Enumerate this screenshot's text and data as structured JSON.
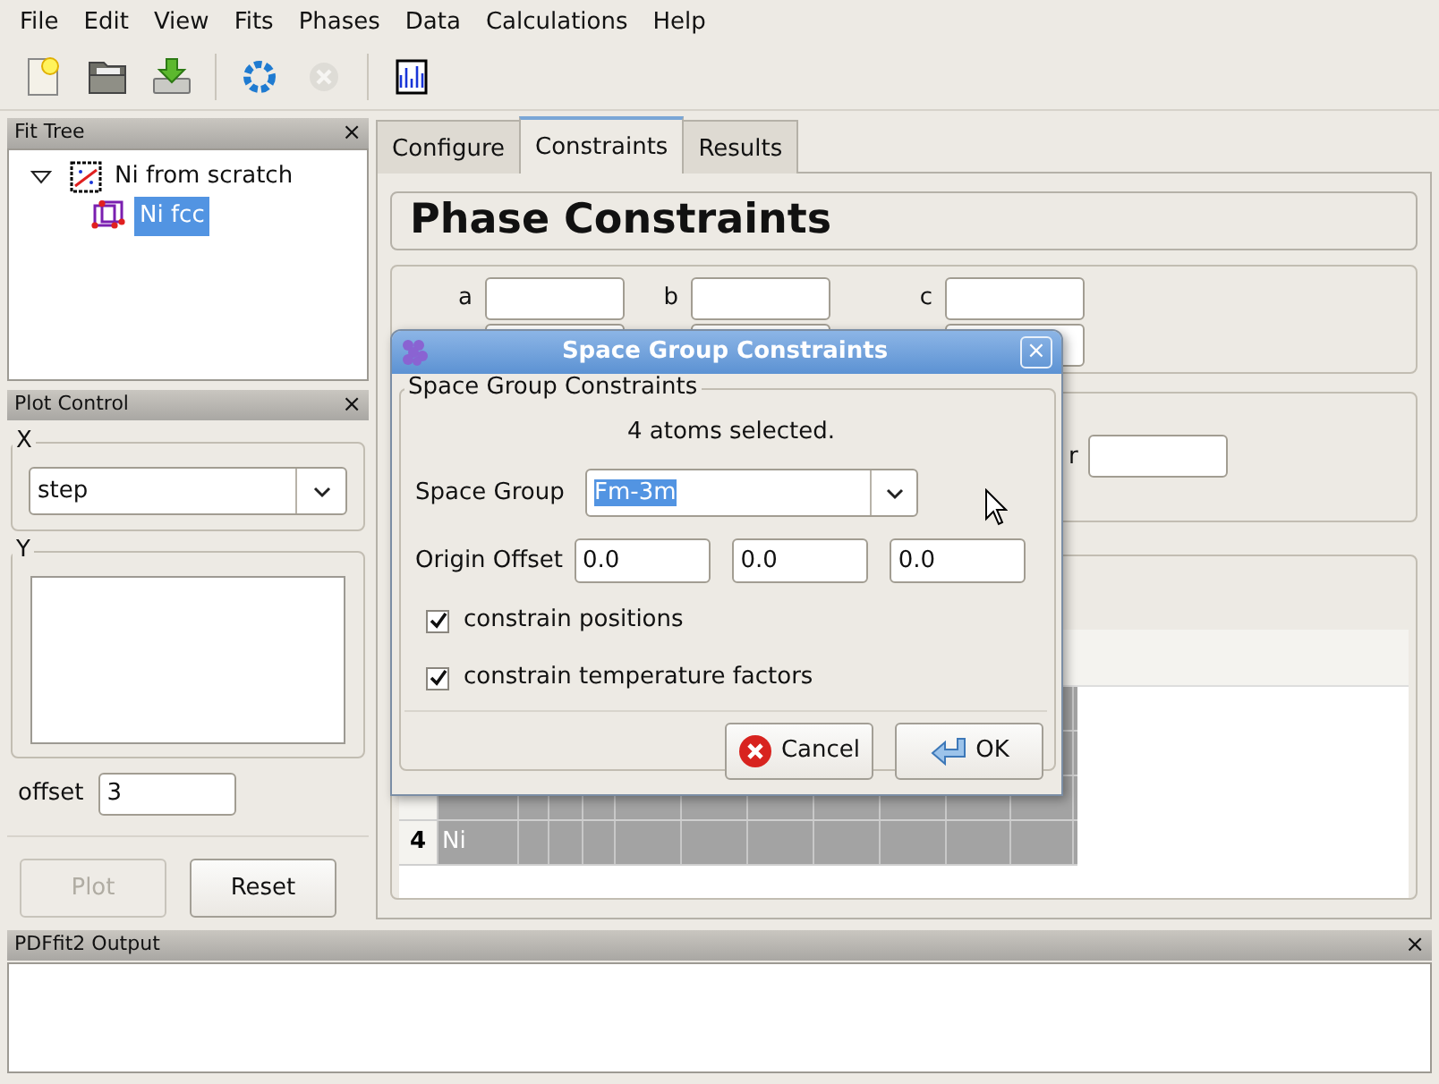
{
  "menu": [
    "File",
    "Edit",
    "View",
    "Fits",
    "Phases",
    "Data",
    "Calculations",
    "Help"
  ],
  "toolbar": [
    {
      "kind": "new",
      "disabled": false
    },
    {
      "kind": "open",
      "disabled": false
    },
    {
      "kind": "save",
      "disabled": false
    },
    {
      "kind": "sep"
    },
    {
      "kind": "run",
      "disabled": false
    },
    {
      "kind": "stop",
      "disabled": true
    },
    {
      "kind": "sep"
    },
    {
      "kind": "plot",
      "disabled": false
    }
  ],
  "fit_tree": {
    "title": "Fit Tree",
    "close": "×",
    "items": [
      {
        "label": "Ni from scratch",
        "kind": "fit",
        "expanded": true,
        "selected": false,
        "children": [
          {
            "label": "Ni fcc",
            "kind": "phase",
            "selected": true
          }
        ]
      }
    ]
  },
  "plot_control": {
    "title": "Plot Control",
    "close": "×",
    "x_group": {
      "label": "X",
      "value": "step"
    },
    "y_group": {
      "label": "Y"
    },
    "offset": {
      "label": "offset",
      "value": "3"
    },
    "buttons": [
      {
        "label": "Plot",
        "disabled": true
      },
      {
        "label": "Reset",
        "disabled": false
      }
    ]
  },
  "tabs": [
    {
      "label": "Configure",
      "selected": false
    },
    {
      "label": "Constraints",
      "selected": true
    },
    {
      "label": "Results",
      "selected": false
    }
  ],
  "heading": "Phase Constraints",
  "lattice": {
    "labels": [
      "a",
      "b",
      "c"
    ]
  },
  "r_label": "r",
  "atoms_table": {
    "rows": [
      {
        "number": "4",
        "element": "Ni"
      }
    ]
  },
  "dialog": {
    "title": "Space Group Constraints",
    "close": "×",
    "group_title": "Space Group Constraints",
    "status": "4 atoms selected.",
    "space_group": {
      "label": "Space Group",
      "value": "Fm-3m"
    },
    "origin_offset": {
      "label": "Origin Offset",
      "values": [
        "0.0",
        "0.0",
        "0.0"
      ]
    },
    "checkboxes": [
      {
        "label": "constrain positions",
        "checked": true
      },
      {
        "label": "constrain temperature factors",
        "checked": true
      }
    ],
    "buttons": [
      {
        "kind": "cancel",
        "label": "Cancel"
      },
      {
        "kind": "ok",
        "label": "OK"
      }
    ]
  },
  "output_panel": {
    "title": "PDFfit2 Output",
    "close": "×"
  }
}
